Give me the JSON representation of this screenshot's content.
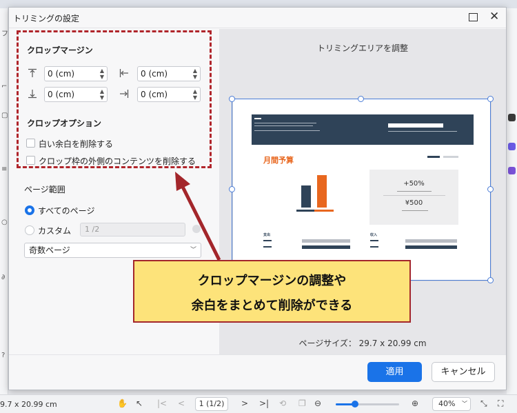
{
  "dialog": {
    "title": "トリミングの設定",
    "crop_margin": {
      "heading": "クロップマージン",
      "top_value": "0 (cm)",
      "left_value": "0 (cm)",
      "bottom_value": "0 (cm)",
      "right_value": "0 (cm)"
    },
    "crop_options": {
      "heading": "クロップオプション",
      "remove_white_margin": "白い余白を削除する",
      "remove_outside_content": "クロップ枠の外側のコンテンツを削除する"
    },
    "page_range": {
      "heading": "ページ範囲",
      "all_pages": "すべてのページ",
      "custom": "カスタム",
      "custom_placeholder": "1 /2",
      "odd_even_selected": "奇数ページ"
    },
    "preview": {
      "title": "トリミングエリアを調整",
      "page_size": "ページサイズ： 29.7 x 20.99 cm",
      "doc_title": "月間予算",
      "stat1": "+50%",
      "stat2": "¥500",
      "sec_left": "支出",
      "sec_right": "収入"
    },
    "buttons": {
      "apply": "適用",
      "cancel": "キャンセル"
    }
  },
  "annotation": {
    "line1": "クロップマージンの調整や",
    "line2": "余白をまとめて削除ができる"
  },
  "statusbar": {
    "page_size": "9.7 x 20.99 cm",
    "page_indicator": "1 (1/2)",
    "zoom": "40%",
    "zoom_fraction": 0.3
  }
}
